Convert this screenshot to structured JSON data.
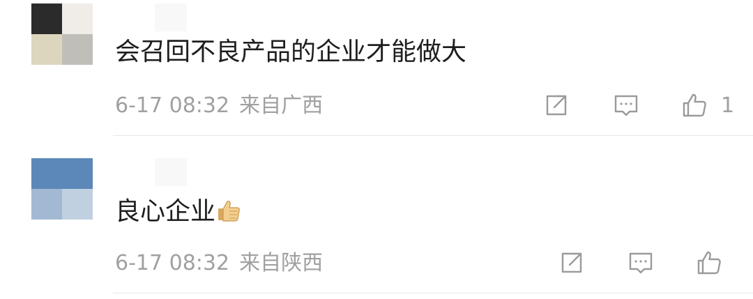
{
  "comments": [
    {
      "text": "会召回不良产品的企业才能做大",
      "time": "6-17 08:32",
      "location": "来自广西",
      "like_count": "1",
      "avatar_colors": [
        "#2b2b2b",
        "#f0ece8",
        "#ddd6bf",
        "#bfbeb8"
      ]
    },
    {
      "text": "良心企业",
      "emoji": "thumbs-up-emoji",
      "time": "6-17 08:32",
      "location": "来自陕西",
      "like_count": "",
      "avatar_colors": [
        "#5b88b8",
        "#5b88b8",
        "#a3b9d3",
        "#c0d0e0"
      ]
    }
  ],
  "icons": {
    "share": "share-icon",
    "reply": "comment-icon",
    "like": "thumbs-up-icon"
  },
  "colors": {
    "text": "#1e1e1e",
    "meta": "#a0a0a0",
    "icon": "#9a9a9a",
    "divider": "#e8e8e8"
  }
}
